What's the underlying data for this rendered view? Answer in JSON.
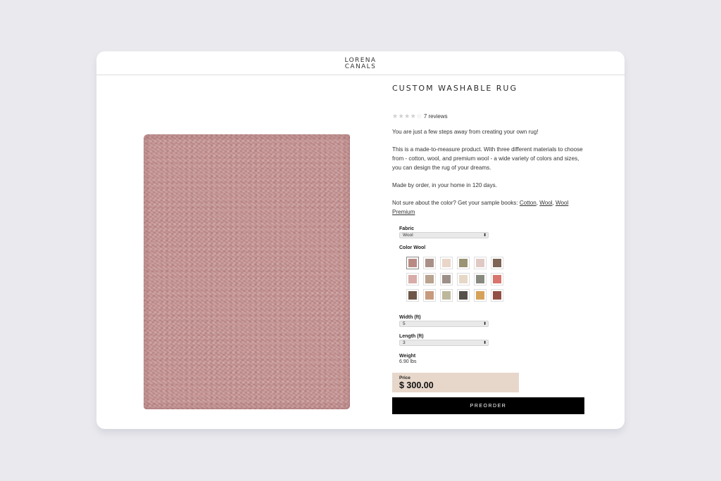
{
  "logo": {
    "line1": "LORENA",
    "line2": "CANALS"
  },
  "product": {
    "title": "CUSTOM WASHABLE RUG",
    "rating_stars": "★★★★☆",
    "reviews": "7 reviews",
    "rug_color": "#c79594"
  },
  "description": {
    "p1": "You are just a few steps away from creating your own rug!",
    "p2": "This is a made-to-measure product. With three different materials to choose from - cotton, wool, and premium wool - a wide variety of colors and sizes, you can design the rug of your dreams.",
    "p3": "Made by order, in your home in 120 days.",
    "p4_prefix": "Not sure about the color? Get your sample books:",
    "link_cotton": "Cotton",
    "link_wool": "Wool",
    "link_wool_premium": "Wool Premium"
  },
  "form": {
    "fabric_label": "Fabric",
    "fabric_value": "Wool",
    "color_label": "Color Wool",
    "swatches": [
      "#b98a84",
      "#a89088",
      "#e9d6c8",
      "#9a9474",
      "#e0c9c4",
      "#7d6456",
      "#d8aca8",
      "#b9a28e",
      "#9c9088",
      "#e6d8c6",
      "#888a80",
      "#d7756e",
      "#6e5748",
      "#c79a7e",
      "#bcb89c",
      "#55504a",
      "#d6a25a",
      "#944f44"
    ],
    "width_label": "Width (ft)",
    "width_value": "5",
    "length_label": "Length (ft)",
    "length_value": "3",
    "weight_label": "Weight",
    "weight_value": "6.90  lbs"
  },
  "price": {
    "label": "Price",
    "value": "$ 300.00",
    "box_color": "#e7d7ca"
  },
  "preorder_label": "PREORDER"
}
